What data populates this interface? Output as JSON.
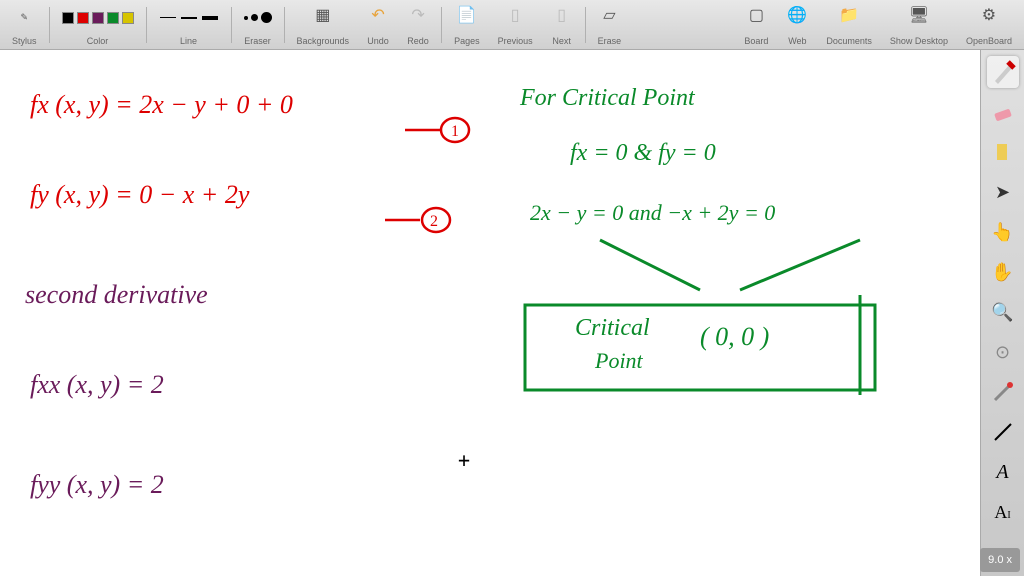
{
  "toolbar": {
    "stylus_label": "Stylus",
    "color_label": "Color",
    "line_label": "Line",
    "eraser_label": "Eraser",
    "backgrounds_label": "Backgrounds",
    "undo_label": "Undo",
    "redo_label": "Redo",
    "pages_label": "Pages",
    "previous_label": "Previous",
    "next_label": "Next",
    "erase_label": "Erase",
    "board_label": "Board",
    "web_label": "Web",
    "documents_label": "Documents",
    "show_desktop_label": "Show Desktop",
    "openboard_label": "OpenBoard",
    "colors": [
      "#000000",
      "#d00000",
      "#6a1b5a",
      "#0a8a2a",
      "#d6c400"
    ]
  },
  "side": {
    "tools": [
      "stylus",
      "eraser",
      "marker",
      "pointer",
      "finger",
      "hand",
      "zoom-in",
      "zoom-fit",
      "laser",
      "line",
      "ruler",
      "text"
    ]
  },
  "zoom": "9.0 x",
  "handwriting": {
    "fx": "fx (x, y) =  2x − y + 0 + 0",
    "eq1": "1",
    "fy": "fy (x, y) =  0 − x + 2y",
    "eq2": "2",
    "forcp": "For Critical  Point",
    "cond": "fx = 0   &   fy = 0",
    "sys": "2x − y = 0   and  −x + 2y = 0",
    "cp1": "Critical",
    "cp2": "Point",
    "cpval": "( 0, 0 )",
    "second": "second  derivative",
    "fxx": "fxx (x, y) =   2",
    "fyy": "fyy (x, y) =   2"
  }
}
